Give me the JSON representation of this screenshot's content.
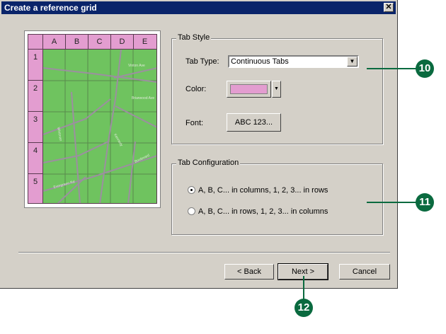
{
  "window": {
    "title": "Create a reference grid",
    "close_glyph": "✕"
  },
  "preview": {
    "columns": [
      "A",
      "B",
      "C",
      "D",
      "E"
    ],
    "rows": [
      "1",
      "2",
      "3",
      "4",
      "5"
    ],
    "tab_color": "#e39dd0",
    "map_color": "#6fc35f",
    "street_labels": [
      "Vinton Ave",
      "Briarwood Ave",
      "Whitman",
      "Kennedy",
      "Boulevard",
      "Evergreen Rd"
    ]
  },
  "tab_style": {
    "group_label": "Tab Style",
    "tab_type_label": "Tab Type:",
    "tab_type_value": "Continuous Tabs",
    "color_label": "Color:",
    "font_label": "Font:",
    "font_button": "ABC 123..."
  },
  "tab_config": {
    "group_label": "Tab Configuration",
    "option1": "A, B, C... in columns, 1, 2, 3... in rows",
    "option2": "A, B, C... in rows, 1, 2, 3... in columns",
    "selected": 1
  },
  "buttons": {
    "back": "< Back",
    "next": "Next >",
    "cancel": "Cancel"
  },
  "callouts": [
    "10",
    "11",
    "12"
  ],
  "icons": {
    "dropdown": "chevron-down-icon",
    "close": "close-icon"
  }
}
